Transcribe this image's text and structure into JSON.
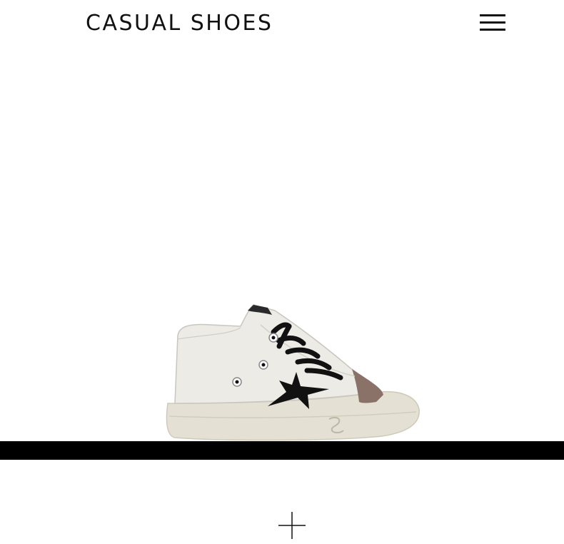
{
  "header": {
    "title": "CASUAL SHOES",
    "menu_icon": "hamburger-menu-icon"
  },
  "product": {
    "image_icon": "sneaker-product-image",
    "colors": {
      "upper": "#ecebe6",
      "sole": "#e4e1d4",
      "toe_cap": "#8a7269",
      "laces": "#111111",
      "star": "#111111"
    }
  },
  "band": {
    "color": "#000000"
  },
  "expand": {
    "icon": "plus-icon"
  }
}
